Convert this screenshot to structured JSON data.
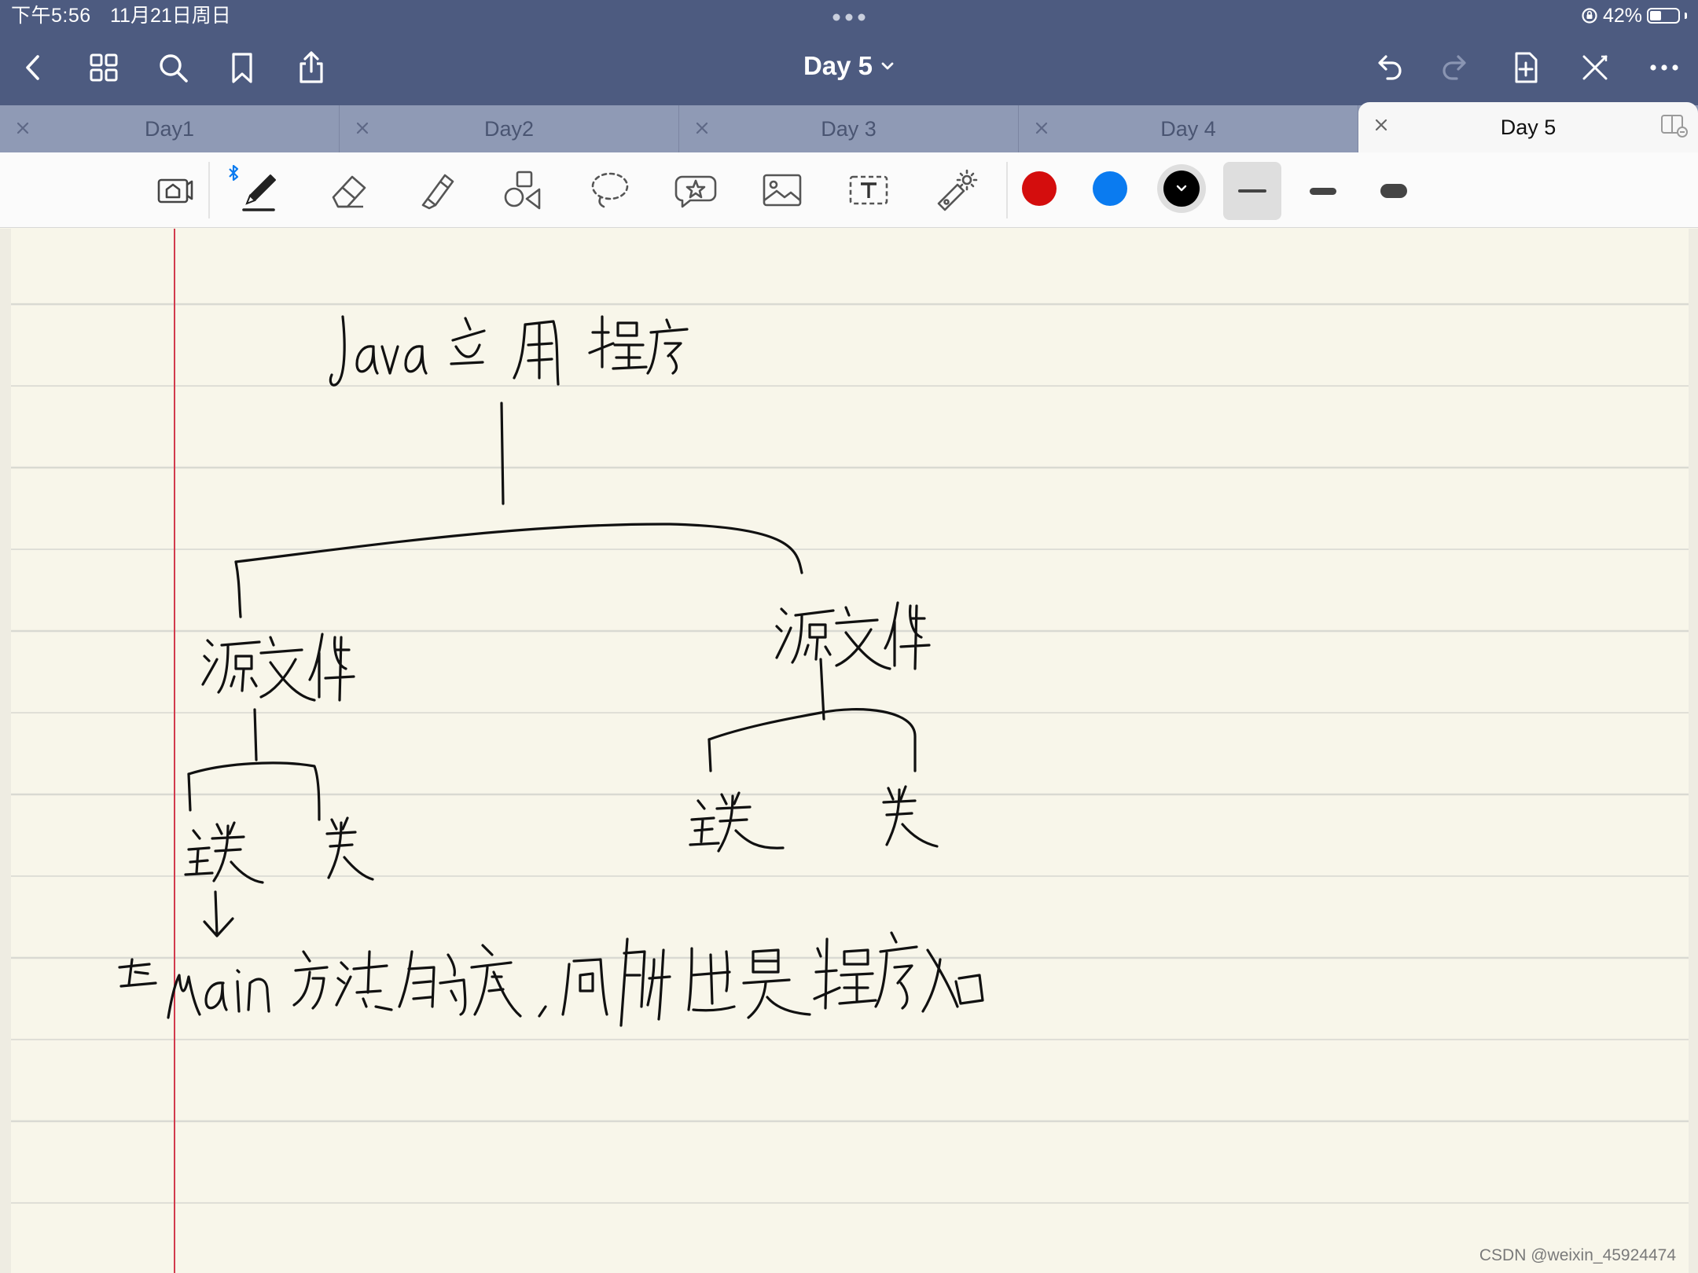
{
  "status_bar": {
    "time": "下午5:56",
    "date": "11月21日周日",
    "battery_text": "42%",
    "battery_level": 0.42
  },
  "nav": {
    "document_title": "Day 5"
  },
  "tabs": [
    {
      "label": "Day1",
      "active": false
    },
    {
      "label": "Day2",
      "active": false
    },
    {
      "label": "Day 3",
      "active": false
    },
    {
      "label": "Day 4",
      "active": false
    },
    {
      "label": "Day 5",
      "active": true
    }
  ],
  "toolbar": {
    "colors": [
      "#d40d0d",
      "#0a7bf0",
      "#000000"
    ],
    "selected_color": "#000000",
    "selected_stroke_index": 0
  },
  "watermark": "CSDN @weixin_45924474"
}
